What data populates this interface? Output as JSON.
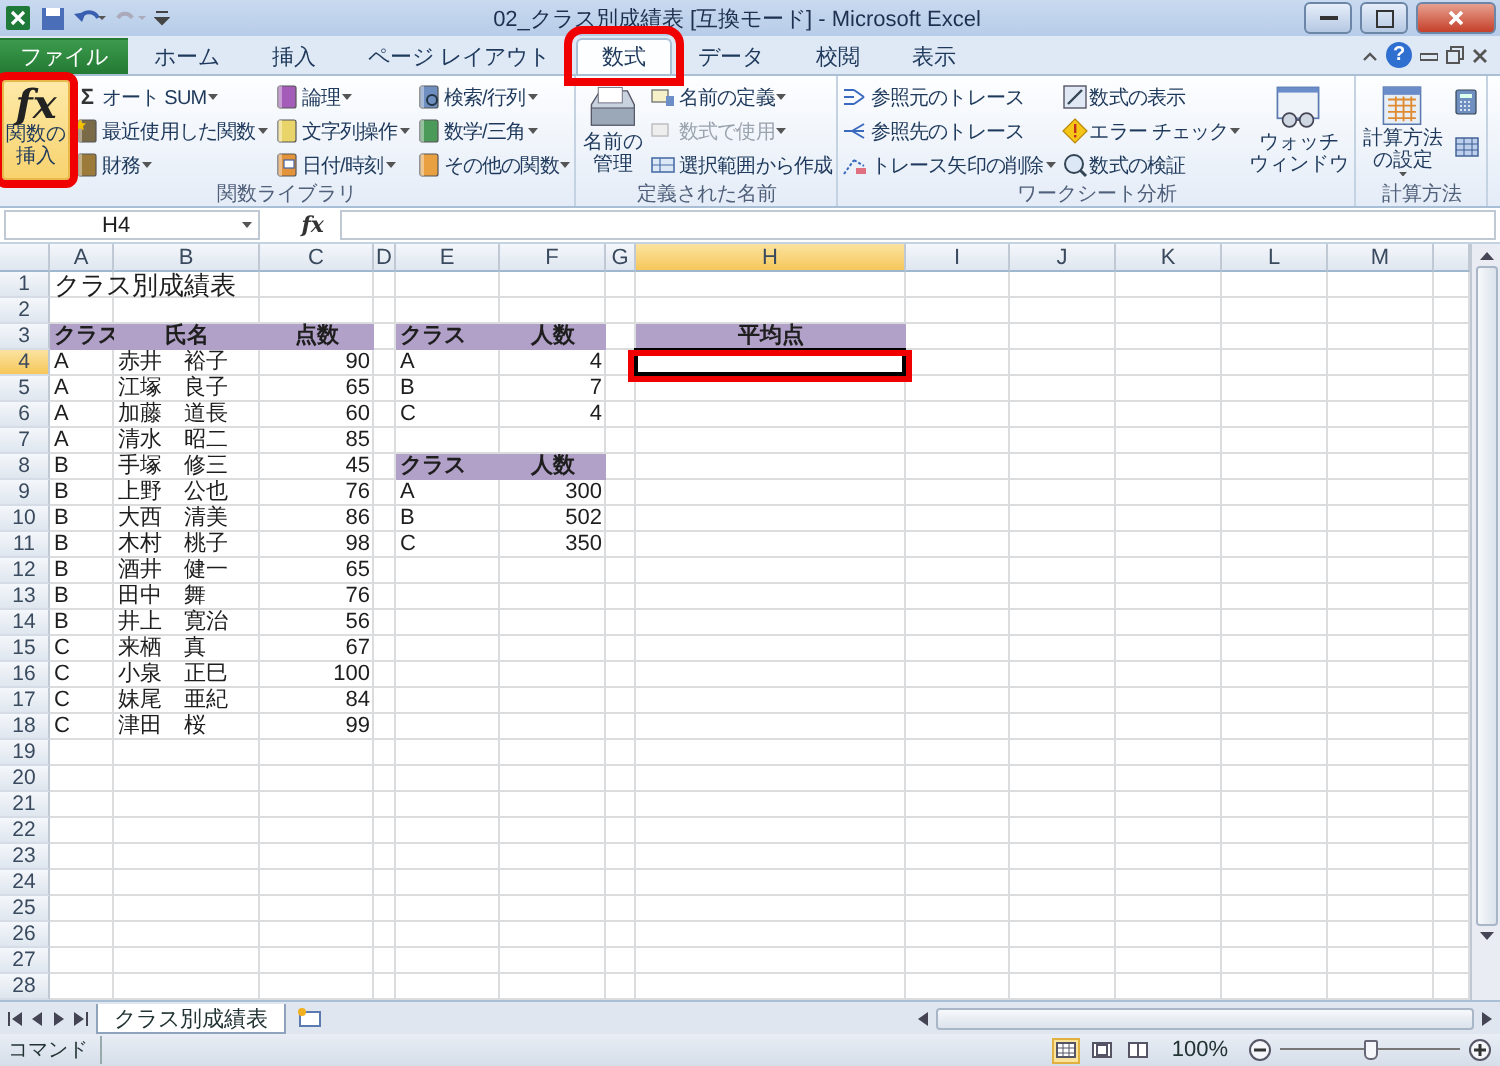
{
  "window": {
    "title": "02_クラス別成績表  [互換モード] - Microsoft Excel"
  },
  "tabs": [
    {
      "label": "ファイル",
      "kind": "file",
      "selected": false,
      "highlighted": false
    },
    {
      "label": "ホーム",
      "kind": "normal",
      "selected": false,
      "highlighted": false
    },
    {
      "label": "挿入",
      "kind": "normal",
      "selected": false,
      "highlighted": false
    },
    {
      "label": "ページ レイアウト",
      "kind": "normal",
      "selected": false,
      "highlighted": false
    },
    {
      "label": "数式",
      "kind": "normal",
      "selected": true,
      "highlighted": true
    },
    {
      "label": "データ",
      "kind": "normal",
      "selected": false,
      "highlighted": false
    },
    {
      "label": "校閲",
      "kind": "normal",
      "selected": false,
      "highlighted": false
    },
    {
      "label": "表示",
      "kind": "normal",
      "selected": false,
      "highlighted": false
    }
  ],
  "help_glyph": "?",
  "ribbon": {
    "groups": [
      {
        "label": "関数ライブラリ",
        "items": [
          {
            "kind": "large",
            "lines": [
              "関数の",
              "挿入"
            ],
            "glyph": "fx",
            "highlighted": true,
            "dropdown": false
          },
          {
            "kind": "stack",
            "items": [
              {
                "label": "オート SUM",
                "glyph": "Σ",
                "dropdown": true,
                "disabled": false
              },
              {
                "label": "最近使用した関数",
                "dropdown": true,
                "disabled": false
              },
              {
                "label": "財務",
                "dropdown": true,
                "disabled": false
              }
            ]
          },
          {
            "kind": "stack",
            "items": [
              {
                "label": "論理",
                "dropdown": true,
                "disabled": false
              },
              {
                "label": "文字列操作",
                "dropdown": true,
                "disabled": false
              },
              {
                "label": "日付/時刻",
                "dropdown": true,
                "disabled": false
              }
            ]
          },
          {
            "kind": "stack",
            "items": [
              {
                "label": "検索/行列",
                "dropdown": true,
                "disabled": false
              },
              {
                "label": "数学/三角",
                "dropdown": true,
                "disabled": false
              },
              {
                "label": "その他の関数",
                "dropdown": true,
                "disabled": false
              }
            ]
          }
        ]
      },
      {
        "label": "定義された名前",
        "items": [
          {
            "kind": "large",
            "lines": [
              "名前の",
              "管理"
            ],
            "highlighted": false,
            "dropdown": false
          },
          {
            "kind": "stack",
            "items": [
              {
                "label": "名前の定義",
                "dropdown": true,
                "disabled": false
              },
              {
                "label": "数式で使用",
                "dropdown": true,
                "disabled": true
              },
              {
                "label": "選択範囲から作成",
                "dropdown": false,
                "disabled": false
              }
            ]
          }
        ]
      },
      {
        "label": "ワークシート分析",
        "items": [
          {
            "kind": "stack",
            "items": [
              {
                "label": "参照元のトレース",
                "dropdown": false,
                "disabled": false
              },
              {
                "label": "参照先のトレース",
                "dropdown": false,
                "disabled": false
              },
              {
                "label": "トレース矢印の削除",
                "dropdown": true,
                "disabled": false
              }
            ]
          },
          {
            "kind": "stack",
            "items": [
              {
                "label": "数式の表示",
                "dropdown": false,
                "disabled": false
              },
              {
                "label": "エラー チェック",
                "dropdown": true,
                "disabled": false
              },
              {
                "label": "数式の検証",
                "dropdown": false,
                "disabled": false
              }
            ]
          },
          {
            "kind": "large",
            "lines": [
              "ウォッチ",
              "ウィンドウ"
            ],
            "highlighted": false,
            "dropdown": false
          }
        ]
      },
      {
        "label": "計算方法",
        "items": [
          {
            "kind": "large",
            "lines": [
              "計算方法",
              "の設定"
            ],
            "highlighted": false,
            "dropdown": true
          },
          {
            "kind": "stack",
            "items": [
              {
                "kind": "icon"
              },
              {
                "kind": "icon"
              }
            ]
          }
        ]
      }
    ]
  },
  "formula_bar": {
    "name_box": "H4",
    "fx_glyph": "fx"
  },
  "sheet": {
    "columns": [
      {
        "label": "A",
        "selected": false
      },
      {
        "label": "B",
        "selected": false
      },
      {
        "label": "C",
        "selected": false
      },
      {
        "label": "D",
        "selected": false
      },
      {
        "label": "E",
        "selected": false
      },
      {
        "label": "F",
        "selected": false
      },
      {
        "label": "G",
        "selected": false
      },
      {
        "label": "H",
        "selected": true
      },
      {
        "label": "I",
        "selected": false
      },
      {
        "label": "J",
        "selected": false
      },
      {
        "label": "K",
        "selected": false
      },
      {
        "label": "L",
        "selected": false
      },
      {
        "label": "M",
        "selected": false
      }
    ],
    "rows": [
      {
        "label": "1",
        "selected": false
      },
      {
        "label": "2",
        "selected": false
      },
      {
        "label": "3",
        "selected": false
      },
      {
        "label": "4",
        "selected": true
      },
      {
        "label": "5",
        "selected": false
      },
      {
        "label": "6",
        "selected": false
      },
      {
        "label": "7",
        "selected": false
      },
      {
        "label": "8",
        "selected": false
      },
      {
        "label": "9",
        "selected": false
      },
      {
        "label": "10",
        "selected": false
      },
      {
        "label": "11",
        "selected": false
      },
      {
        "label": "12",
        "selected": false
      },
      {
        "label": "13",
        "selected": false
      },
      {
        "label": "14",
        "selected": false
      },
      {
        "label": "15",
        "selected": false
      },
      {
        "label": "16",
        "selected": false
      },
      {
        "label": "17",
        "selected": false
      },
      {
        "label": "18",
        "selected": false
      },
      {
        "label": "19",
        "selected": false
      },
      {
        "label": "20",
        "selected": false
      },
      {
        "label": "21",
        "selected": false
      },
      {
        "label": "22",
        "selected": false
      },
      {
        "label": "23",
        "selected": false
      },
      {
        "label": "24",
        "selected": false
      },
      {
        "label": "25",
        "selected": false
      },
      {
        "label": "26",
        "selected": false
      },
      {
        "label": "27",
        "selected": false
      },
      {
        "label": "28",
        "selected": false
      }
    ],
    "title_cell": "クラス別成績表",
    "score_table": {
      "headers": [
        "クラス",
        "氏名",
        "点数"
      ],
      "rows": [
        [
          "A",
          "赤井　裕子",
          "90"
        ],
        [
          "A",
          "江塚　良子",
          "65"
        ],
        [
          "A",
          "加藤　道長",
          "60"
        ],
        [
          "A",
          "清水　昭二",
          "85"
        ],
        [
          "B",
          "手塚　修三",
          "45"
        ],
        [
          "B",
          "上野　公也",
          "76"
        ],
        [
          "B",
          "大西　清美",
          "86"
        ],
        [
          "B",
          "木村　桃子",
          "98"
        ],
        [
          "B",
          "酒井　健一",
          "65"
        ],
        [
          "B",
          "田中　舞",
          "76"
        ],
        [
          "B",
          "井上　寛治",
          "56"
        ],
        [
          "C",
          "来栖　真",
          "67"
        ],
        [
          "C",
          "小泉　正巳",
          "100"
        ],
        [
          "C",
          "妹尾　亜紀",
          "84"
        ],
        [
          "C",
          "津田　桜",
          "99"
        ]
      ]
    },
    "count_table": {
      "headers": [
        "クラス",
        "人数"
      ],
      "rows": [
        [
          "A",
          "4"
        ],
        [
          "B",
          "7"
        ],
        [
          "C",
          "4"
        ]
      ]
    },
    "total_table": {
      "headers": [
        "クラス",
        "人数"
      ],
      "rows": [
        [
          "A",
          "300"
        ],
        [
          "B",
          "502"
        ],
        [
          "C",
          "350"
        ]
      ]
    },
    "average_table": {
      "header": "平均点",
      "cell_selected": true,
      "highlighted": true
    }
  },
  "sheet_tabs": [
    {
      "label": "クラス別成績表",
      "selected": true
    }
  ],
  "status_bar": {
    "mode": "コマンド",
    "views": [
      {
        "selected": true
      },
      {
        "selected": false
      },
      {
        "selected": false
      }
    ],
    "zoom": "100%",
    "zoom_slider": {
      "level": 0.5
    }
  }
}
